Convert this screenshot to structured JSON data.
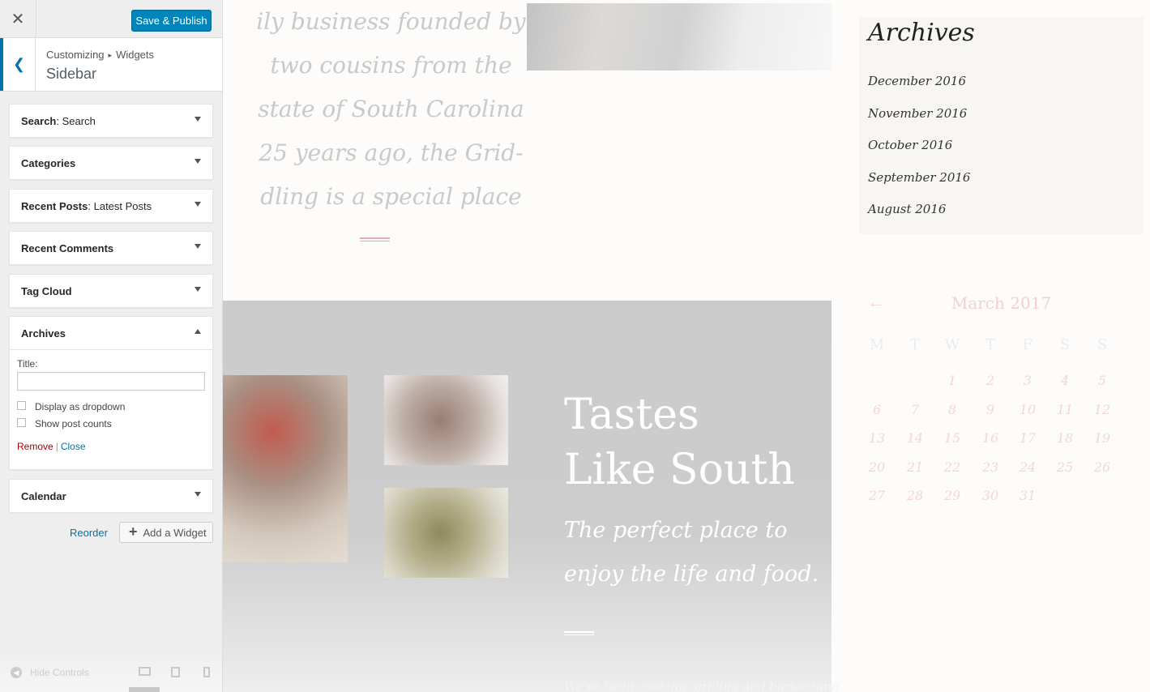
{
  "panel": {
    "close_icon": "close-icon",
    "save_label": "Save & Publish",
    "breadcrumb": [
      "Customizing",
      "Widgets"
    ],
    "section_title": "Sidebar",
    "widgets": [
      {
        "name": "Search",
        "sub": "Search"
      },
      {
        "name": "Categories",
        "sub": ""
      },
      {
        "name": "Recent Posts",
        "sub": "Latest Posts"
      },
      {
        "name": "Recent Comments",
        "sub": ""
      },
      {
        "name": "Tag Cloud",
        "sub": ""
      },
      {
        "name": "Archives",
        "sub": ""
      },
      {
        "name": "Calendar",
        "sub": ""
      }
    ],
    "archives_form": {
      "title_label": "Title:",
      "title_value": "",
      "dropdown_label": "Display as dropdown",
      "counts_label": "Show post counts",
      "remove_label": "Remove",
      "separator": "|",
      "close_label": "Close"
    },
    "reorder_label": "Reorder",
    "add_widget_label": "Add a Widget",
    "hide_controls_label": "Hide Controls"
  },
  "preview": {
    "intro_lines": [
      "ily business founded by",
      "two cousins from the",
      "state of South Carolina",
      "25 years ago, the Grid-",
      "dling is a special place"
    ],
    "band_title": [
      "Tastes",
      "Like South"
    ],
    "band_subtitle": "The perfect place to enjoy the life and food.",
    "band_faint": "We've been cooking, grilling and barbecuing",
    "archives_title": "Archives",
    "archives": [
      "December 2016",
      "November 2016",
      "October 2016",
      "September 2016",
      "August 2016"
    ],
    "calendar": {
      "title": "March 2017",
      "days": [
        "M",
        "T",
        "W",
        "T",
        "F",
        "S",
        "S"
      ],
      "weeks": [
        [
          "",
          "",
          "1",
          "2",
          "3",
          "4",
          "5"
        ],
        [
          "6",
          "7",
          "8",
          "9",
          "10",
          "11",
          "12"
        ],
        [
          "13",
          "14",
          "15",
          "16",
          "17",
          "18",
          "19"
        ],
        [
          "20",
          "21",
          "22",
          "23",
          "24",
          "25",
          "26"
        ],
        [
          "27",
          "28",
          "29",
          "30",
          "31",
          "",
          ""
        ]
      ]
    }
  },
  "colors": {
    "primary_button": "#0085ba",
    "link": "#0073aa",
    "remove_link": "#aa0000",
    "accent_pink": "#e7aab5"
  }
}
